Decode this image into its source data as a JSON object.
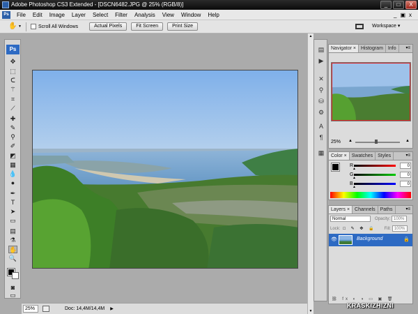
{
  "titlebar": {
    "title": "Adobe Photoshop CS3 Extended - [DSCN6482.JPG @ 25% (RGB/8)]",
    "min": "_",
    "max": "□",
    "close": "X"
  },
  "menubar": {
    "ps": "Ps",
    "items": [
      "File",
      "Edit",
      "Image",
      "Layer",
      "Select",
      "Filter",
      "Analysis",
      "View",
      "Window",
      "Help"
    ],
    "restore": "▣",
    "min": "_",
    "close": "x"
  },
  "options": {
    "scroll_all_label": "Scroll All Windows",
    "actual_pixels": "Actual Pixels",
    "fit_screen": "Fit Screen",
    "print_size": "Print Size",
    "workspace": "Workspace ▾"
  },
  "toolbox": {
    "logo": "Ps"
  },
  "statusbar": {
    "zoom": "25%",
    "doc_size": "Doc: 14,4M/14,4M",
    "arrow": "▶"
  },
  "navigator": {
    "tabs": [
      "Navigator ×",
      "Histogram",
      "Info"
    ],
    "zoom": "25%"
  },
  "color": {
    "tabs": [
      "Color ×",
      "Swatches",
      "Styles"
    ],
    "rows": [
      {
        "label": "R",
        "value": "0"
      },
      {
        "label": "G",
        "value": "0"
      },
      {
        "label": "B",
        "value": "0"
      }
    ]
  },
  "layers": {
    "tabs": [
      "Layers ×",
      "Channels",
      "Paths"
    ],
    "blend_mode": "Normal",
    "opacity_label": "Opacity:",
    "opacity_value": "100%",
    "lock_label": "Lock:",
    "fill_label": "Fill:",
    "fill_value": "100%",
    "layer_name": "Background"
  },
  "watermark": "KRASKIZHIZNI",
  "colors": {
    "accent": "#2d6ac3",
    "titlebar": "#111111",
    "canvas_bg": "#ababab"
  }
}
